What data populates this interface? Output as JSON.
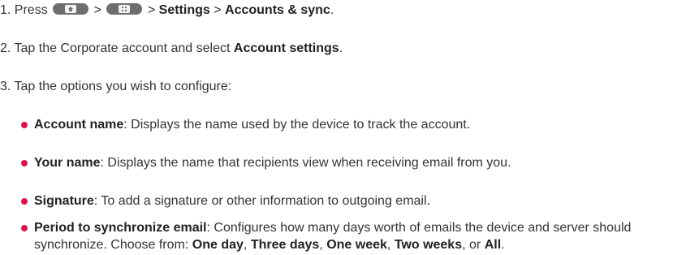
{
  "steps": {
    "step1": {
      "prefix": "1. Press",
      "sep1": ">",
      "sep2": ">",
      "settings": "Settings",
      "sep3": ">",
      "accounts_sync": "Accounts & sync",
      "end": ".",
      "home_key_icon": "home-key-icon",
      "menu_key_icon": "menu-key-icon"
    },
    "step2": {
      "text": "2. Tap the Corporate account and select",
      "bold": "Account settings",
      "end": "."
    },
    "step3": {
      "text": "3. Tap the options you wish to configure:"
    }
  },
  "options": [
    {
      "label": "Account name",
      "desc": ": Displays the name used by the device to track the account."
    },
    {
      "label": "Your name",
      "desc": ": Displays the name that recipients view when receiving email from you."
    },
    {
      "label": "Signature",
      "desc": ": To add a signature or other information to outgoing email."
    },
    {
      "label": "Period to synchronize email",
      "desc": ": Configures how many days worth of emails the device and server should",
      "line2_prefix": "synchronize. Choose from:",
      "choices": [
        "One day",
        "Three days",
        "One week",
        "Two weeks",
        "All"
      ],
      "sep_comma": ",",
      "sep_or": ", or",
      "end": "."
    }
  ],
  "colors": {
    "bullet": "#d6174c",
    "key": "#6e6e6e"
  }
}
